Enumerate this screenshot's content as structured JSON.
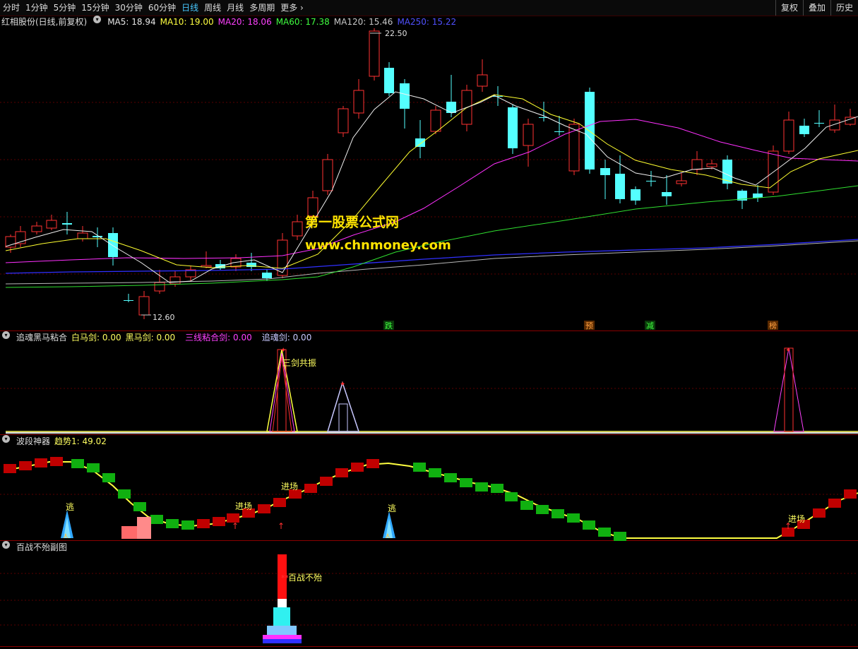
{
  "toolbar": {
    "periods": [
      "分时",
      "1分钟",
      "5分钟",
      "15分钟",
      "30分钟",
      "60分钟",
      "日线",
      "周线",
      "月线",
      "多周期",
      "更多"
    ],
    "active_index": 6,
    "right_buttons": [
      "复权",
      "叠加",
      "历史"
    ]
  },
  "main_panel": {
    "stock_name": "红相股份(日线,前复权)",
    "ma": [
      {
        "label": "MA5: 18.94",
        "color": "#e6e6e6"
      },
      {
        "label": "MA10: 19.00",
        "color": "#ffff40"
      },
      {
        "label": "MA20: 18.06",
        "color": "#ff40ff"
      },
      {
        "label": "MA60: 17.38",
        "color": "#40ff40"
      },
      {
        "label": "MA120: 15.46",
        "color": "#c8c8c8"
      },
      {
        "label": "MA250: 15.22",
        "color": "#4040ff"
      }
    ],
    "high_label": "22.50",
    "low_label": "12.60",
    "signal_tags": [
      "跌",
      "预",
      "减",
      "榜"
    ]
  },
  "watermark": {
    "line1": "第一股票公式网",
    "line2": "www.chnmoney.com"
  },
  "panel2": {
    "title": "追魂黑马粘合",
    "values": [
      {
        "label": "白马剑: 0.00",
        "color": "#ffff60"
      },
      {
        "label": "黑马剑: 0.00",
        "color": "#ffff60"
      },
      {
        "label": "三线粘合剑: 0.00",
        "color": "#ff40ff"
      },
      {
        "label": "追魂剑: 0.00",
        "color": "#c8c8ff"
      }
    ],
    "annotation": "三剑共振"
  },
  "panel3": {
    "title": "波段神器",
    "trend_label": "趋势1: 49.02",
    "labels": {
      "escape": "逃",
      "enter": "进场"
    }
  },
  "panel4": {
    "title": "百战不殆副图",
    "annotation": "百战不殆"
  }
}
